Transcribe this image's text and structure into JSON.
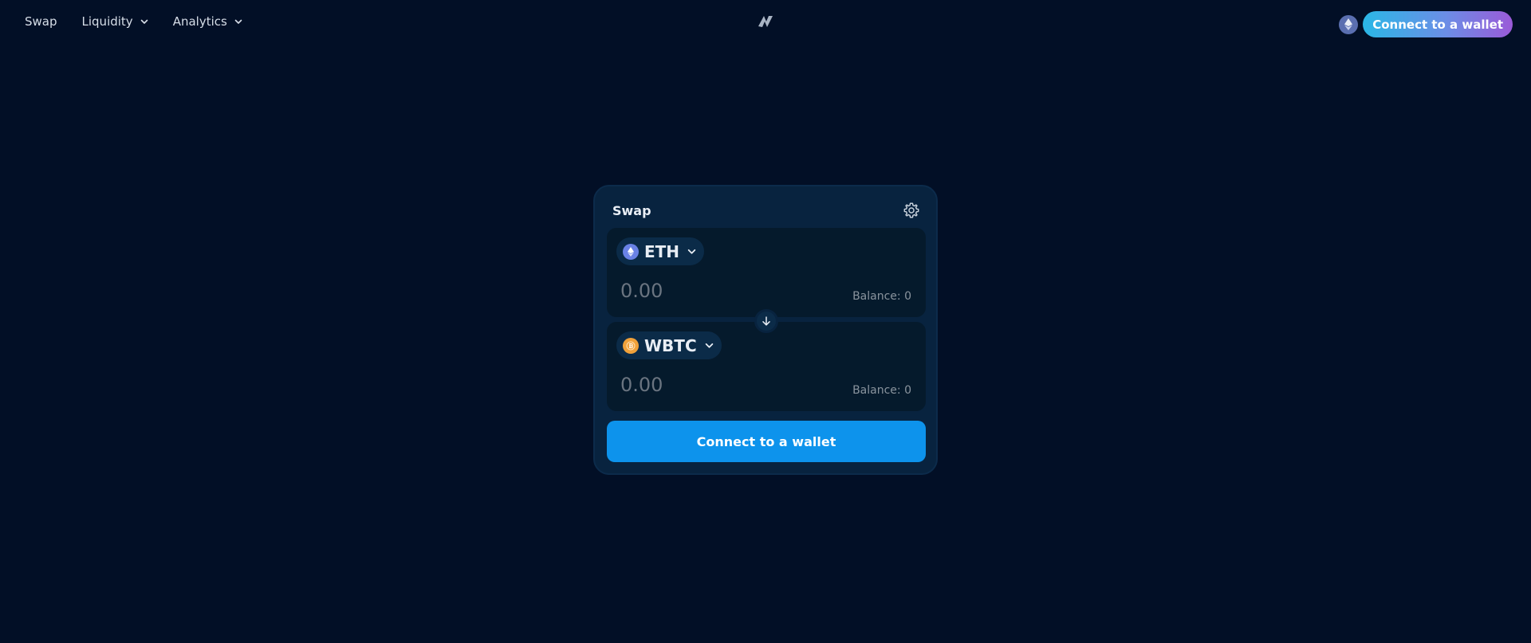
{
  "nav": {
    "items": [
      {
        "label": "Swap",
        "has_dropdown": false
      },
      {
        "label": "Liquidity",
        "has_dropdown": true
      },
      {
        "label": "Analytics",
        "has_dropdown": true
      }
    ],
    "logo_icon": "app-logo-icon",
    "network_icon": "ethereum-network-icon",
    "connect_label": "Connect to a wallet"
  },
  "swap": {
    "title": "Swap",
    "settings_icon": "gear-icon",
    "from": {
      "token": "ETH",
      "token_icon": "ethereum-icon",
      "amount_placeholder": "0.00",
      "balance": "Balance: 0"
    },
    "switch_icon": "arrow-down-icon",
    "to": {
      "token": "WBTC",
      "token_icon": "bitcoin-icon",
      "amount_placeholder": "0.00",
      "balance": "Balance: 0"
    },
    "connect_label": "Connect to a wallet"
  },
  "colors": {
    "background": "#020f26",
    "card": "#08233f",
    "panel": "#051a2c",
    "primary_button": "#0d93ec"
  }
}
